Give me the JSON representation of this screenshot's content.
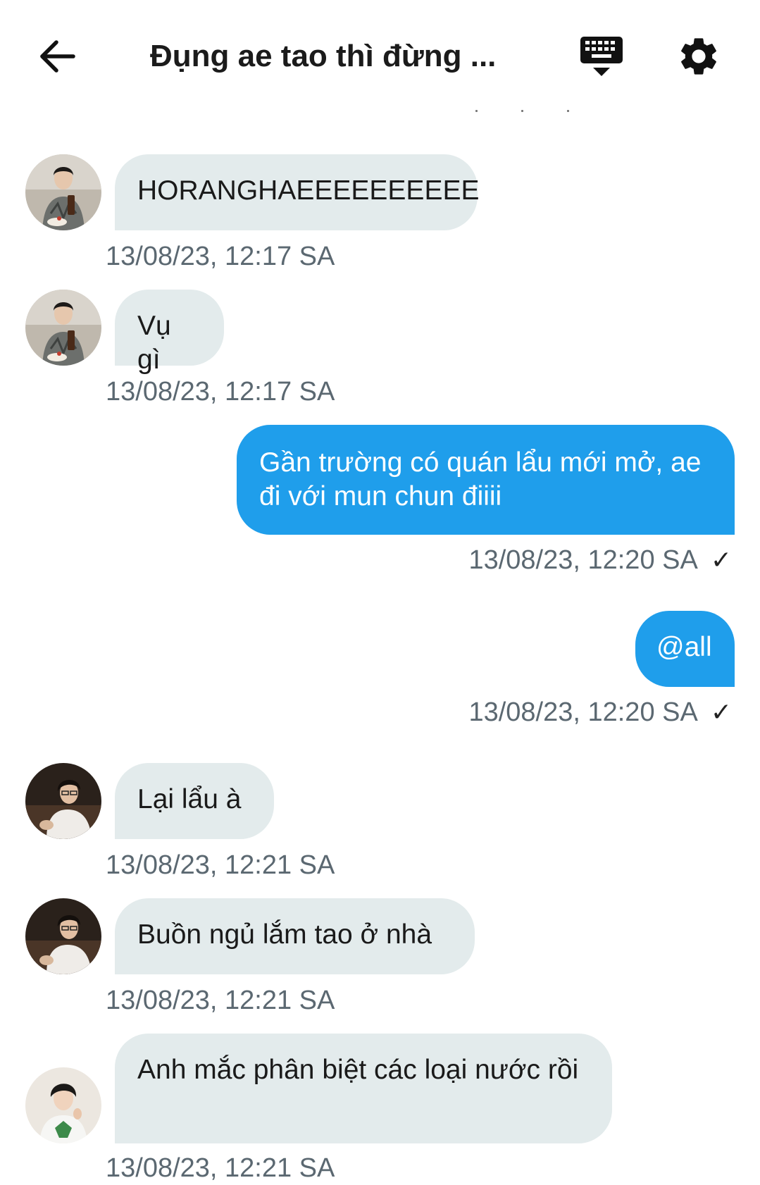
{
  "header": {
    "title": "Đụng ae tao thì đừng ...",
    "back_icon": "arrow-left-icon",
    "keyboard_icon": "keyboard-hide-icon",
    "settings_icon": "gear-icon"
  },
  "colors": {
    "incoming_bubble": "#e3ebec",
    "outgoing_bubble": "#1f9eeb",
    "timestamp": "#5b6871"
  },
  "messages": [
    {
      "direction": "in",
      "avatar": "avatar-user-a",
      "text": "HORANGHAEEEEEEEEEE",
      "time": "13/08/23, 12:17 SA"
    },
    {
      "direction": "in",
      "avatar": "avatar-user-a",
      "text": "Vụ gì",
      "time": "13/08/23, 12:17 SA"
    },
    {
      "direction": "out",
      "text": "Gần trường có quán lẩu mới mở, ae đi với mun chun điiii",
      "time": "13/08/23, 12:20 SA",
      "status": "✓"
    },
    {
      "direction": "out",
      "text": "@all",
      "time": "13/08/23, 12:20 SA",
      "status": "✓"
    },
    {
      "direction": "in",
      "avatar": "avatar-user-b",
      "text": "Lại lẩu à",
      "time": "13/08/23, 12:21 SA"
    },
    {
      "direction": "in",
      "avatar": "avatar-user-b",
      "text": "Buồn ngủ lắm tao ở nhà",
      "time": "13/08/23, 12:21 SA"
    },
    {
      "direction": "in",
      "avatar": "avatar-user-c",
      "text": "Anh mắc phân biệt các loại nước rồi",
      "time": "13/08/23, 12:21 SA"
    }
  ]
}
